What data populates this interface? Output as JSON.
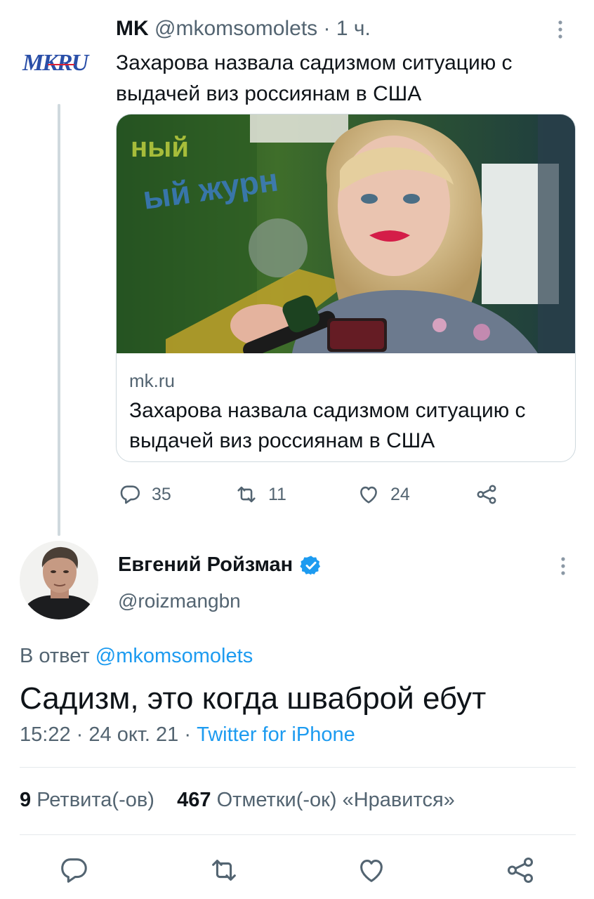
{
  "parent_tweet": {
    "logo_text": "MKRU",
    "author_name": "MK",
    "handle": "@mkomsomolets",
    "separator": "·",
    "time": "1 ч.",
    "text": "Захарова назвала садизмом ситуацию с выдачей виз россиянам в США",
    "card": {
      "domain": "mk.ru",
      "title": "Захарова назвала садизмом ситуацию с выдачей виз россиянам в США"
    },
    "actions": {
      "replies": "35",
      "retweets": "11",
      "likes": "24"
    }
  },
  "tweet": {
    "author_name": "Евгений Ройзман",
    "handle": "@roizmangbn",
    "reply_prefix": "В ответ",
    "reply_handle": "@mkomsomolets",
    "text": "Садизм, это когда шваброй ебут",
    "time": "15:22",
    "date": "24 окт. 21",
    "separator": "·",
    "source": "Twitter for iPhone",
    "retweets_count": "9",
    "retweets_label": "Ретвита(-ов)",
    "likes_count": "467",
    "likes_label": "Отметки(-ок) «Нравится»"
  },
  "colors": {
    "accent": "#1d9bf0",
    "secondary_text": "#536471",
    "logo_blue": "#2a4fa8"
  },
  "icons": [
    "more-icon",
    "reply-icon",
    "retweet-icon",
    "like-icon",
    "share-icon",
    "verified-icon"
  ]
}
